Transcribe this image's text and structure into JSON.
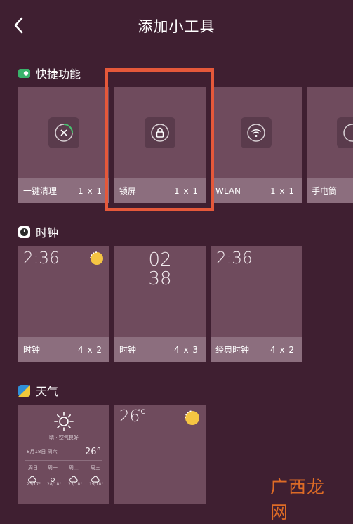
{
  "header": {
    "title": "添加小工具"
  },
  "sections": {
    "shortcuts": {
      "title": "快捷功能",
      "items": [
        {
          "label": "一键清理",
          "size": "1 x 1",
          "icon": "clean-icon"
        },
        {
          "label": "锁屏",
          "size": "1 x 1",
          "icon": "lock-icon"
        },
        {
          "label": "WLAN",
          "size": "1 x 1",
          "icon": "wifi-icon"
        },
        {
          "label": "手电筒",
          "icon": "flashlight-icon"
        }
      ]
    },
    "clock": {
      "title": "时钟",
      "items": [
        {
          "label": "时钟",
          "size": "4 x 2",
          "time": "2:36"
        },
        {
          "label": "时钟",
          "size": "4 x 3",
          "hour": "02",
          "minute": "38"
        },
        {
          "label": "经典时钟",
          "size": "4 x 2",
          "time": "2:36"
        }
      ]
    },
    "weather": {
      "title": "天气",
      "items": [
        {
          "condition": "晴 · 空气良好",
          "date": "8月18日 周六",
          "temp": "26°",
          "days": [
            "周日",
            "周一",
            "周二",
            "周三"
          ],
          "ranges": [
            "23/17°",
            "28/18°",
            "23/18°",
            "19/18°"
          ]
        },
        {
          "temp": "26",
          "unit": "°C"
        }
      ]
    }
  },
  "watermark": {
    "text": "广西龙网"
  },
  "colors": {
    "background": "#3f1f31",
    "card": "#6f4b5d",
    "card_footer": "#8c6e7e",
    "highlight": "#e5583a",
    "sun": "#f5c543"
  }
}
